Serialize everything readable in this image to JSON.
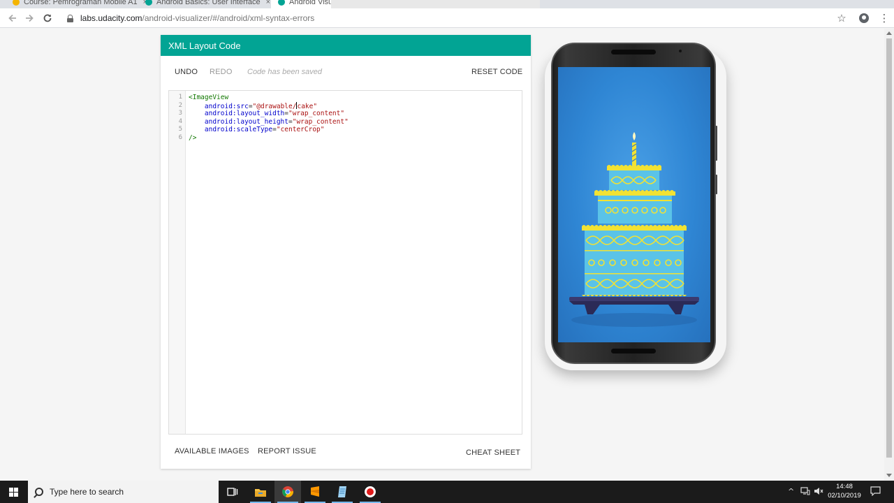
{
  "browser": {
    "tabs": [
      {
        "label": "Course: Pemrograman Mobile A1",
        "icon_color": "#f4b400",
        "close": "×"
      },
      {
        "label": "Android Basics: User Interface",
        "icon_color": "#02a494",
        "close": "×"
      },
      {
        "label": "Android Visualizer",
        "icon_color": "#02a494",
        "close": "×"
      }
    ],
    "back_icon": "arrow-left-icon",
    "forward_icon": "arrow-right-icon",
    "reload_icon": "reload-icon",
    "url_host": "labs.udacity.com",
    "url_path": "/android-visualizer/#/android/xml-syntax-errors",
    "star_glyph": "☆",
    "menu_glyph": "⋮"
  },
  "panel": {
    "title": "XML Layout Code",
    "undo_label": "UNDO",
    "redo_label": "REDO",
    "status": "Code has been saved",
    "reset_label": "RESET CODE",
    "available_images_label": "AVAILABLE IMAGES",
    "report_issue_label": "REPORT ISSUE",
    "cheat_sheet_label": "CHEAT SHEET",
    "colors": {
      "header": "#02a494",
      "button_active": "#333333",
      "button_disabled": "#999999"
    }
  },
  "code": {
    "line_numbers": [
      "1",
      "2",
      "3",
      "4",
      "5",
      "6"
    ],
    "open_tag": "<ImageView",
    "lines": [
      {
        "attr": "android:src",
        "eq": "=",
        "value_before_caret": "\"@drawable/",
        "value_after_caret": "cake\""
      },
      {
        "attr": "android:layout_width",
        "eq": "=",
        "value": "\"wrap_content\""
      },
      {
        "attr": "android:layout_height",
        "eq": "=",
        "value": "\"wrap_content\""
      },
      {
        "attr": "android:scaleType",
        "eq": "=",
        "value": "\"centerCrop\""
      }
    ],
    "close_tag": "/>"
  },
  "preview": {
    "image": "cake-illustration",
    "screen_color": "#2f86d4"
  },
  "taskbar": {
    "search_placeholder": "Type here to search",
    "apps": [
      "task-view-icon",
      "file-explorer-icon",
      "chrome-icon",
      "sublime-text-icon",
      "notepad-icon",
      "record-icon"
    ],
    "tray": {
      "chevron": "^",
      "time": "14:48",
      "date": "02/10/2019"
    }
  }
}
